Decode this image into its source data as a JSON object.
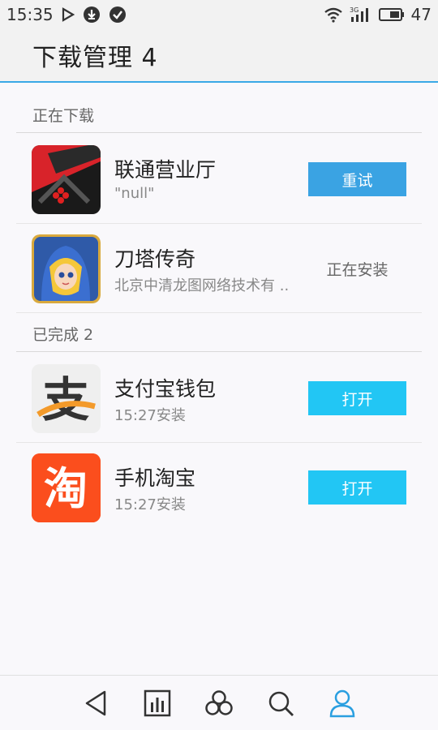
{
  "status_bar": {
    "time": "15:35",
    "battery": "47"
  },
  "header": {
    "title": "下载管理 4"
  },
  "sections": {
    "downloading": {
      "label": "正在下载"
    },
    "completed": {
      "label": "已完成 2"
    }
  },
  "apps": [
    {
      "name": "联通营业厅",
      "sub": "\"null\"",
      "action": "重试",
      "icon": "unicom-app-icon"
    },
    {
      "name": "刀塔传奇",
      "sub": "北京中清龙图网络技术有 ..",
      "status": "正在安装",
      "icon": "dota-legend-app-icon"
    },
    {
      "name": "支付宝钱包",
      "sub": "15:27安装",
      "action": "打开",
      "icon": "alipay-app-icon"
    },
    {
      "name": "手机淘宝",
      "sub": "15:27安装",
      "action": "打开",
      "icon": "taobao-app-icon"
    }
  ],
  "icon_texts": {
    "taobao_char": "淘",
    "alipay_char": "支"
  },
  "colors": {
    "accent": "#3aa9e6",
    "retry_button": "#3aa3e3",
    "open_button": "#22c6f4",
    "taobao": "#fb4e1d"
  }
}
